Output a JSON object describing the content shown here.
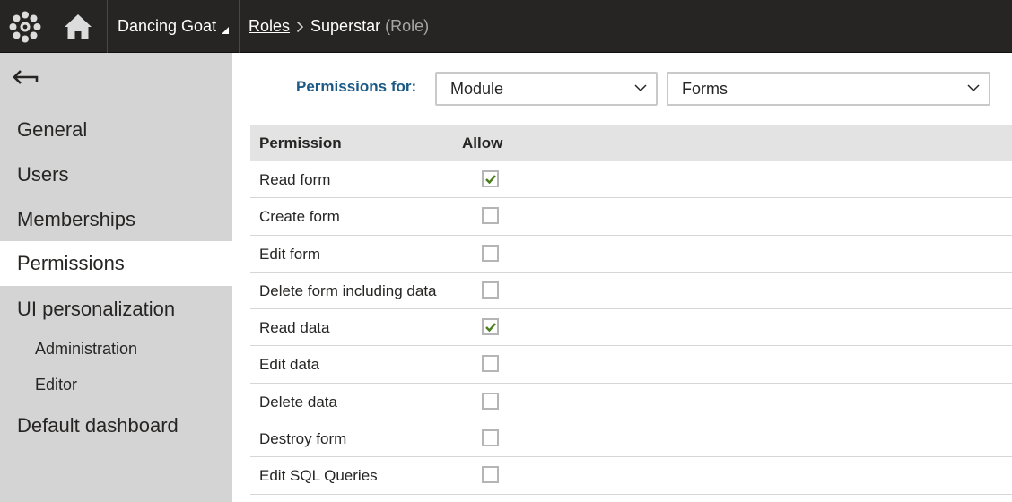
{
  "header": {
    "site_name": "Dancing Goat",
    "breadcrumb": {
      "parent": "Roles",
      "current": "Superstar",
      "type": "(Role)"
    }
  },
  "sidebar": {
    "items": [
      {
        "label": "General",
        "active": false
      },
      {
        "label": "Users",
        "active": false
      },
      {
        "label": "Memberships",
        "active": false
      },
      {
        "label": "Permissions",
        "active": true
      },
      {
        "label": "UI personalization",
        "active": false
      }
    ],
    "subitems": [
      {
        "label": "Administration"
      },
      {
        "label": "Editor"
      }
    ],
    "last_item": {
      "label": "Default dashboard"
    }
  },
  "permissions_for": {
    "label": "Permissions for:",
    "type_select": "Module",
    "module_select": "Forms"
  },
  "table": {
    "columns": [
      "Permission",
      "Allow"
    ],
    "rows": [
      {
        "name": "Read form",
        "allowed": true
      },
      {
        "name": "Create form",
        "allowed": false
      },
      {
        "name": "Edit form",
        "allowed": false
      },
      {
        "name": "Delete form including data",
        "allowed": false
      },
      {
        "name": "Read data",
        "allowed": true
      },
      {
        "name": "Edit data",
        "allowed": false
      },
      {
        "name": "Delete data",
        "allowed": false
      },
      {
        "name": "Destroy form",
        "allowed": false
      },
      {
        "name": "Edit SQL Queries",
        "allowed": false
      }
    ]
  },
  "colors": {
    "topbar": "#262524",
    "sidebar": "#d4d4d4",
    "accent_label": "#1c5a86",
    "check": "#497d1b"
  },
  "icons": {
    "logo": "kentico-gear-icon",
    "home": "home-icon",
    "back": "back-arrow-icon",
    "select_chevron": "chevron-down-icon",
    "check": "checkmark-icon"
  }
}
